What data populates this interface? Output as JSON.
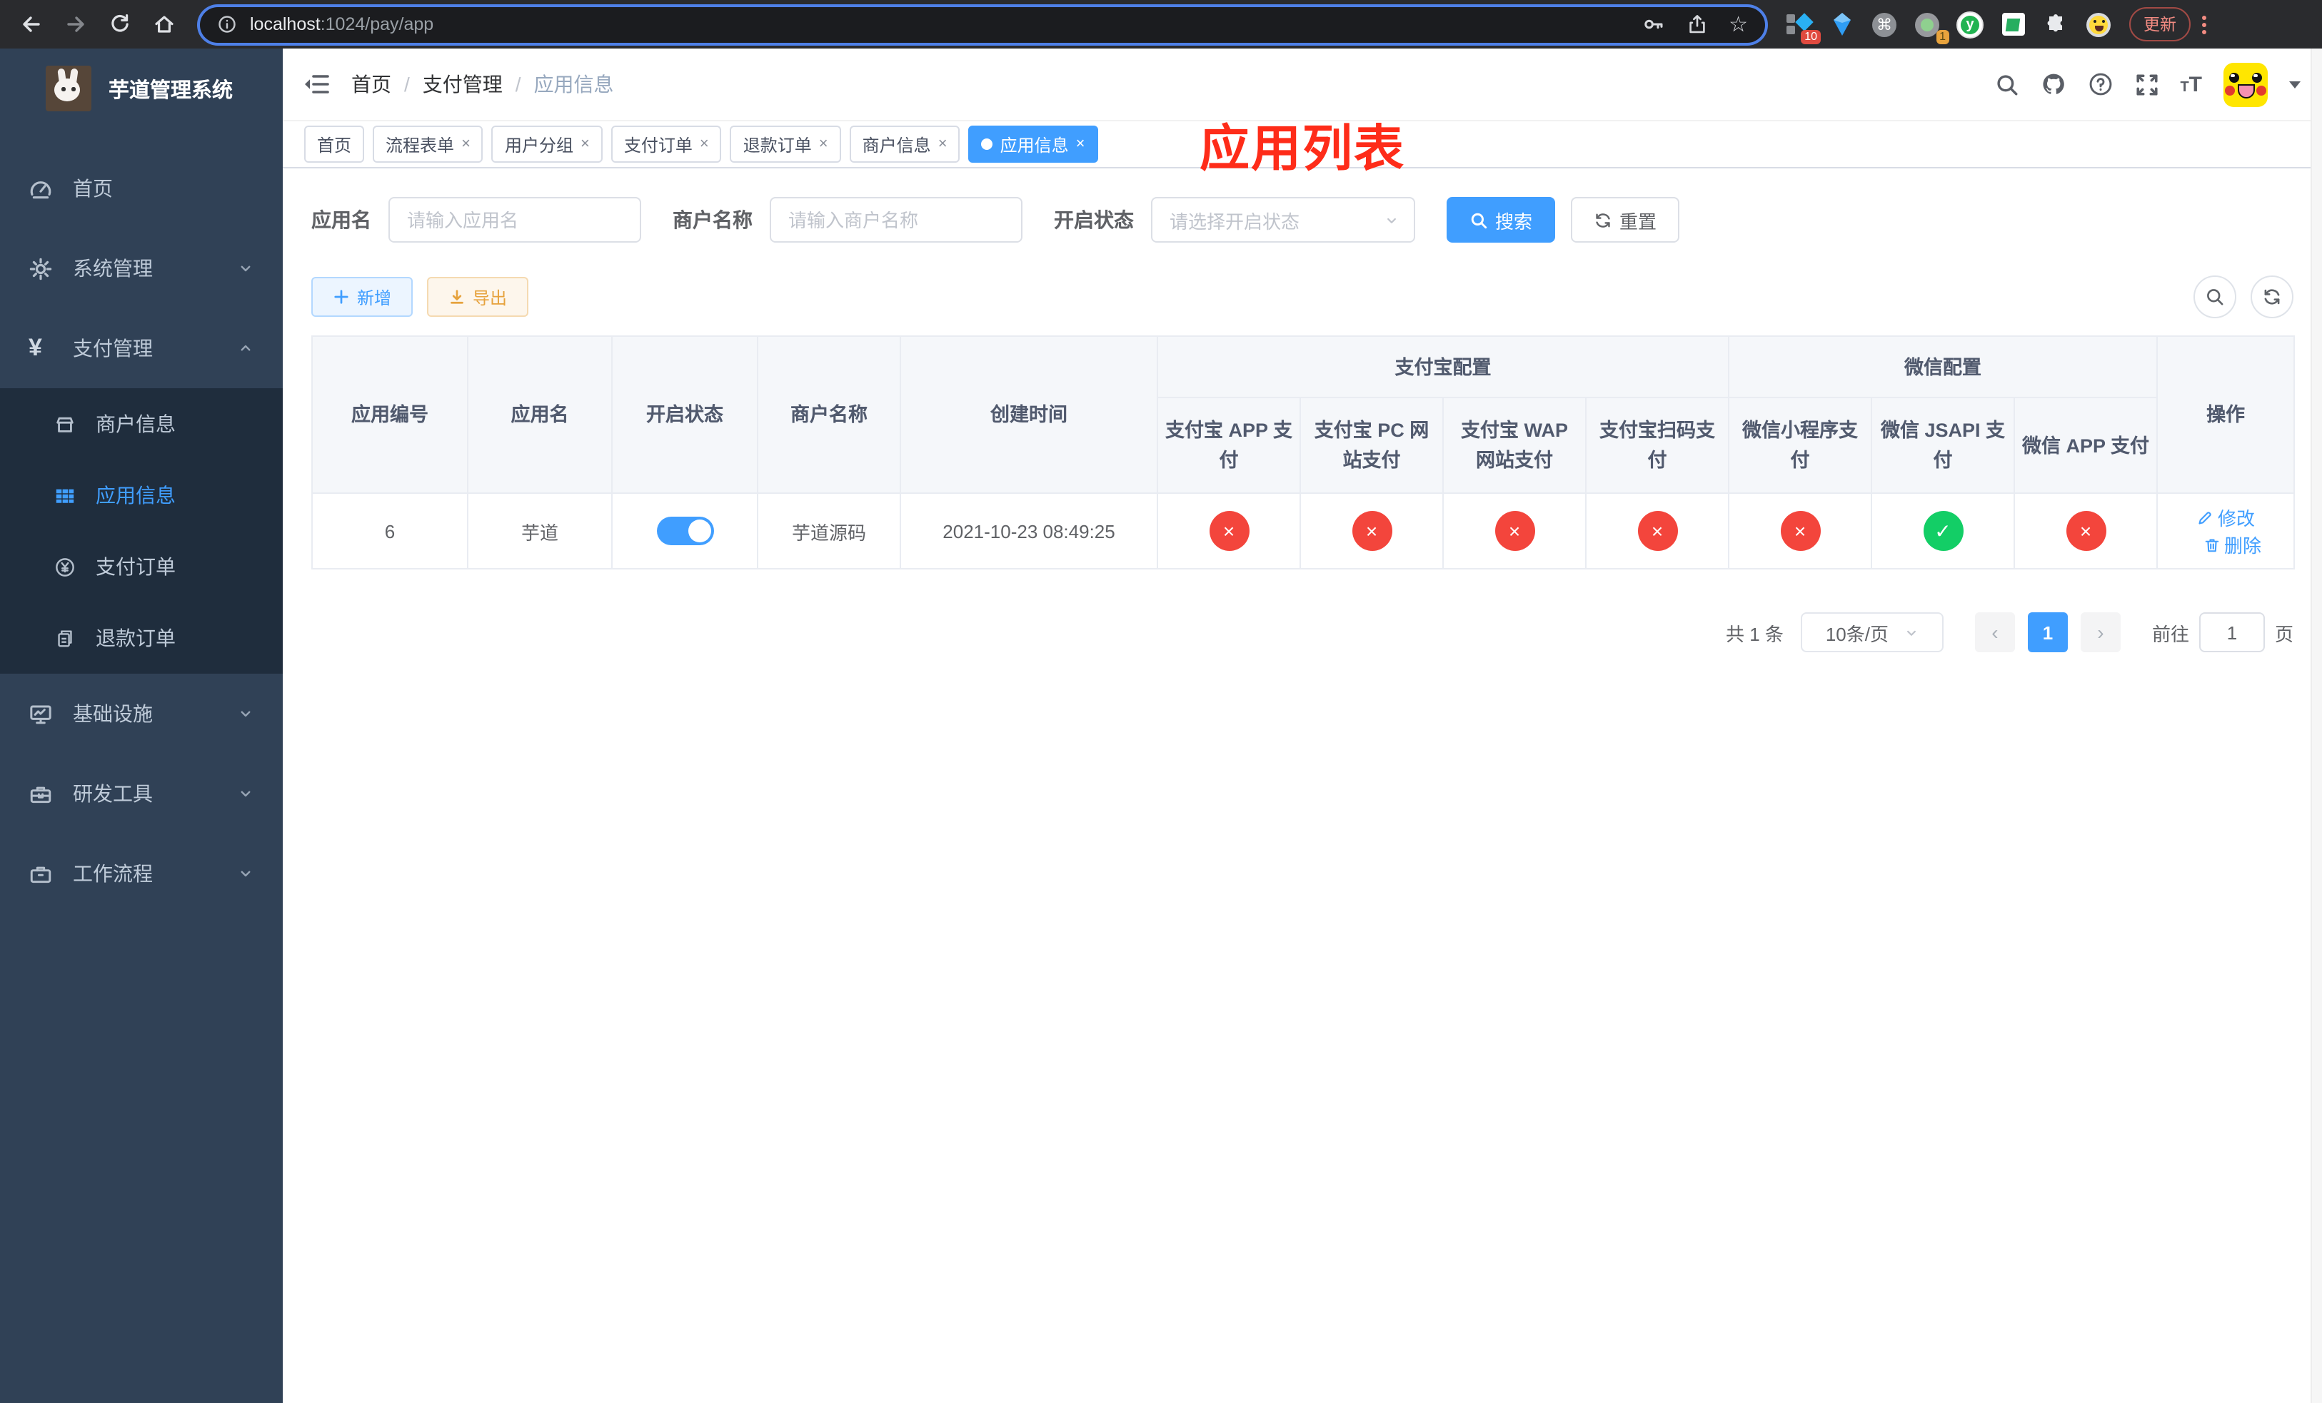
{
  "colors": {
    "accent": "#409eff",
    "success": "#13ce66",
    "danger": "#f3453c",
    "annotation": "#fe2c19",
    "sidebar_bg": "#304156",
    "submenu_bg": "#1f2d3d"
  },
  "browser": {
    "url_host": "localhost",
    "url_rest": ":1024/pay/app",
    "update_label": "更新",
    "ext_badge_pin": "10",
    "ext_badge_rec": "1"
  },
  "sidebar": {
    "title": "芋道管理系统",
    "menu": {
      "home": "首页",
      "system": "系统管理",
      "pay": "支付管理",
      "merchant": "商户信息",
      "app": "应用信息",
      "pay_order": "支付订单",
      "refund_order": "退款订单",
      "infra": "基础设施",
      "dev_tools": "研发工具",
      "workflow": "工作流程"
    }
  },
  "navbar": {
    "breadcrumb": [
      "首页",
      "支付管理",
      "应用信息"
    ],
    "overlay_title": "应用列表"
  },
  "tabs": [
    {
      "label": "首页",
      "closable": false,
      "active": false
    },
    {
      "label": "流程表单",
      "closable": true,
      "active": false
    },
    {
      "label": "用户分组",
      "closable": true,
      "active": false
    },
    {
      "label": "支付订单",
      "closable": true,
      "active": false
    },
    {
      "label": "退款订单",
      "closable": true,
      "active": false
    },
    {
      "label": "商户信息",
      "closable": true,
      "active": false
    },
    {
      "label": "应用信息",
      "closable": true,
      "active": true
    }
  ],
  "filters": {
    "app_name_label": "应用名",
    "app_name_placeholder": "请输入应用名",
    "merchant_label": "商户名称",
    "merchant_placeholder": "请输入商户名称",
    "status_label": "开启状态",
    "status_placeholder": "请选择开启状态",
    "search_label": "搜索",
    "reset_label": "重置"
  },
  "toolbar": {
    "add_label": "新增",
    "export_label": "导出"
  },
  "table": {
    "columns": {
      "id": "应用编号",
      "name": "应用名",
      "enabled": "开启状态",
      "merchant": "商户名称",
      "created": "创建时间",
      "alipay_group": "支付宝配置",
      "wechat_group": "微信配置",
      "ops": "操作",
      "channels": [
        "支付宝 APP 支付",
        "支付宝 PC 网站支付",
        "支付宝 WAP 网站支付",
        "支付宝扫码支付",
        "微信小程序支付",
        "微信 JSAPI 支付",
        "微信 APP 支付"
      ]
    },
    "row": {
      "id": "6",
      "name": "芋道",
      "enabled": true,
      "merchant": "芋道源码",
      "created": "2021-10-23 08:49:25",
      "channels": [
        false,
        false,
        false,
        false,
        false,
        true,
        false
      ],
      "edit_label": "修改",
      "delete_label": "删除"
    }
  },
  "pagination": {
    "total_label": "共 1 条",
    "page_size": "10条/页",
    "current_page": "1",
    "goto_label": "前往",
    "goto_value": "1",
    "page_unit_label": "页"
  }
}
